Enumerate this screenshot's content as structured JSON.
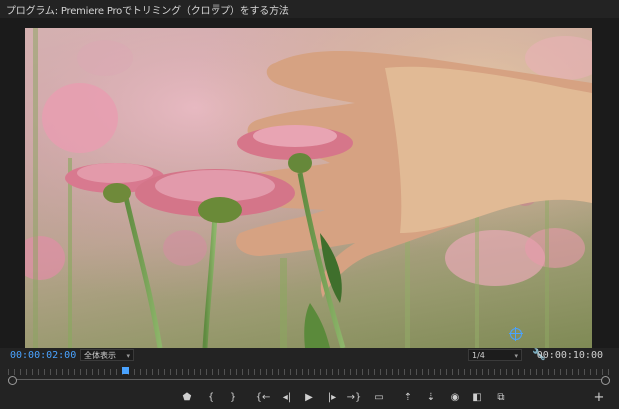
{
  "panel": {
    "title": "プログラム: Premiere Proでトリミング（クロップ）をする方法",
    "menu_icon": "≡"
  },
  "viewer": {
    "image_icon": "video-frame"
  },
  "info_bar": {
    "current_timecode": "00:00:02:00",
    "fit_label": "全体表示",
    "resolution_label": "1/4",
    "duration_timecode": "00:00:10:00",
    "settings_icon": "wrench-icon"
  },
  "transport": {
    "buttons": [
      {
        "name": "add-marker-button",
        "glyph": "⬟"
      },
      {
        "name": "mark-in-button",
        "glyph": "{"
      },
      {
        "name": "mark-out-button",
        "glyph": "}"
      },
      {
        "name": "go-to-in-button",
        "glyph": "{←"
      },
      {
        "name": "step-back-button",
        "glyph": "◂|"
      },
      {
        "name": "play-button",
        "glyph": "▶"
      },
      {
        "name": "step-forward-button",
        "glyph": "|▸"
      },
      {
        "name": "go-to-out-button",
        "glyph": "→}"
      },
      {
        "name": "safe-margins-button",
        "glyph": "▭"
      },
      {
        "name": "lift-button",
        "glyph": "⇡"
      },
      {
        "name": "extract-button",
        "glyph": "⇣"
      },
      {
        "name": "export-frame-button",
        "glyph": "◉"
      },
      {
        "name": "compare-view-button",
        "glyph": "◧"
      },
      {
        "name": "proxy-toggle-button",
        "glyph": "⧉"
      },
      {
        "name": "button-editor-button",
        "glyph": "+"
      }
    ]
  },
  "colors": {
    "accent": "#4aa3ff",
    "background": "#232323"
  }
}
